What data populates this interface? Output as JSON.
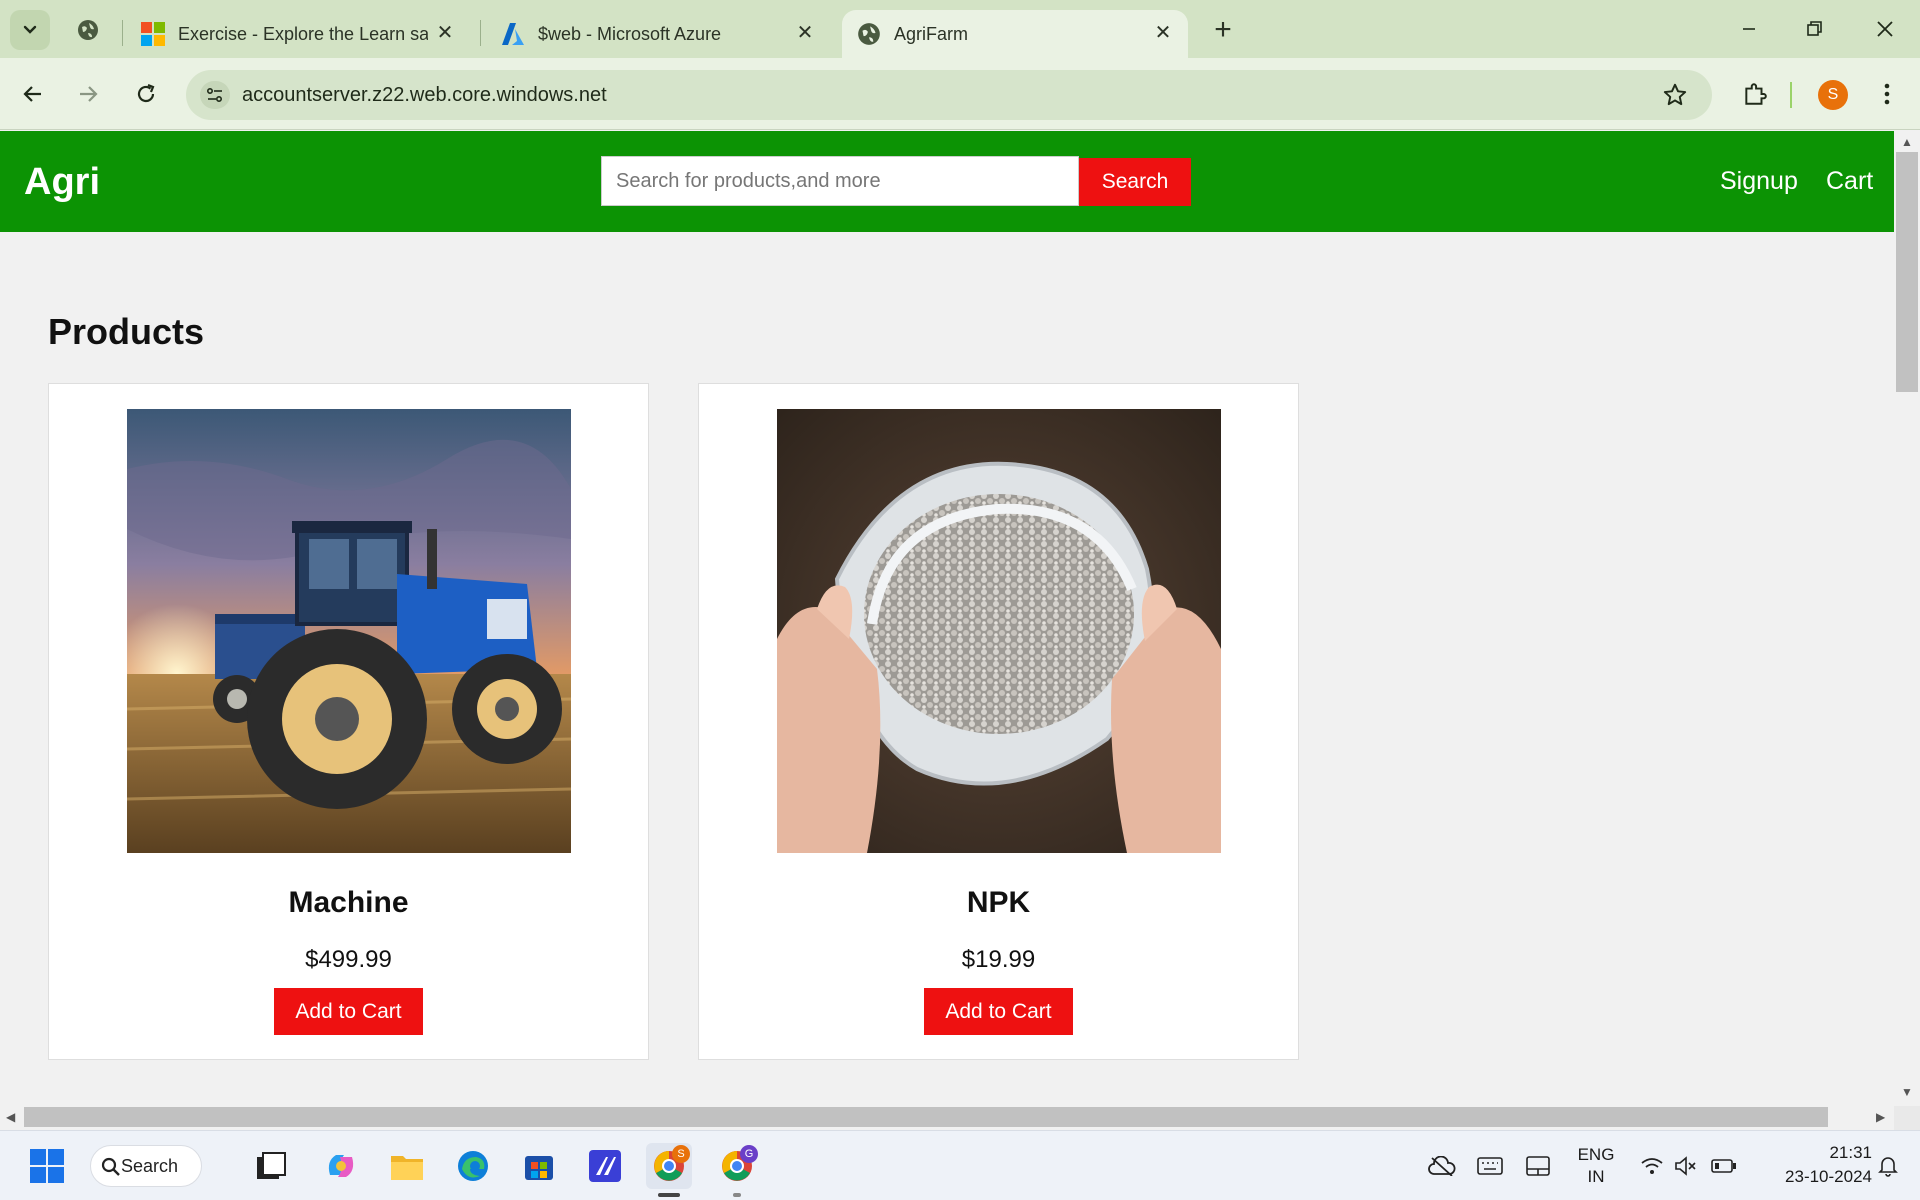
{
  "browser": {
    "tabs": [
      {
        "title": "Exercise - Explore the Learn san",
        "favicon": "microsoft-logo"
      },
      {
        "title": "$web - Microsoft Azure",
        "favicon": "azure-logo"
      },
      {
        "title": "AgriFarm",
        "favicon": "globe-icon",
        "active": true
      }
    ],
    "url": "accountserver.z22.web.core.windows.net",
    "profile_initial": "S",
    "profile_color": "#e8710a"
  },
  "site": {
    "logo": "Agri",
    "search_placeholder": "Search for products,and more",
    "search_button": "Search",
    "nav": {
      "signup": "Signup",
      "cart": "Cart"
    },
    "header_color": "#0c9304",
    "accent_color": "#ee1111"
  },
  "products_section": {
    "title": "Products",
    "products": [
      {
        "name": "Machine",
        "price": "$499.99",
        "button": "Add to Cart",
        "image": "tractor-photo"
      },
      {
        "name": "NPK",
        "price": "$19.99",
        "button": "Add to Cart",
        "image": "fertilizer-bag-photo"
      }
    ]
  },
  "taskbar": {
    "search_label": "Search",
    "language": "ENG",
    "region": "IN",
    "time": "21:31",
    "date": "23-10-2024",
    "chrome_badges": [
      "S",
      "G"
    ]
  }
}
